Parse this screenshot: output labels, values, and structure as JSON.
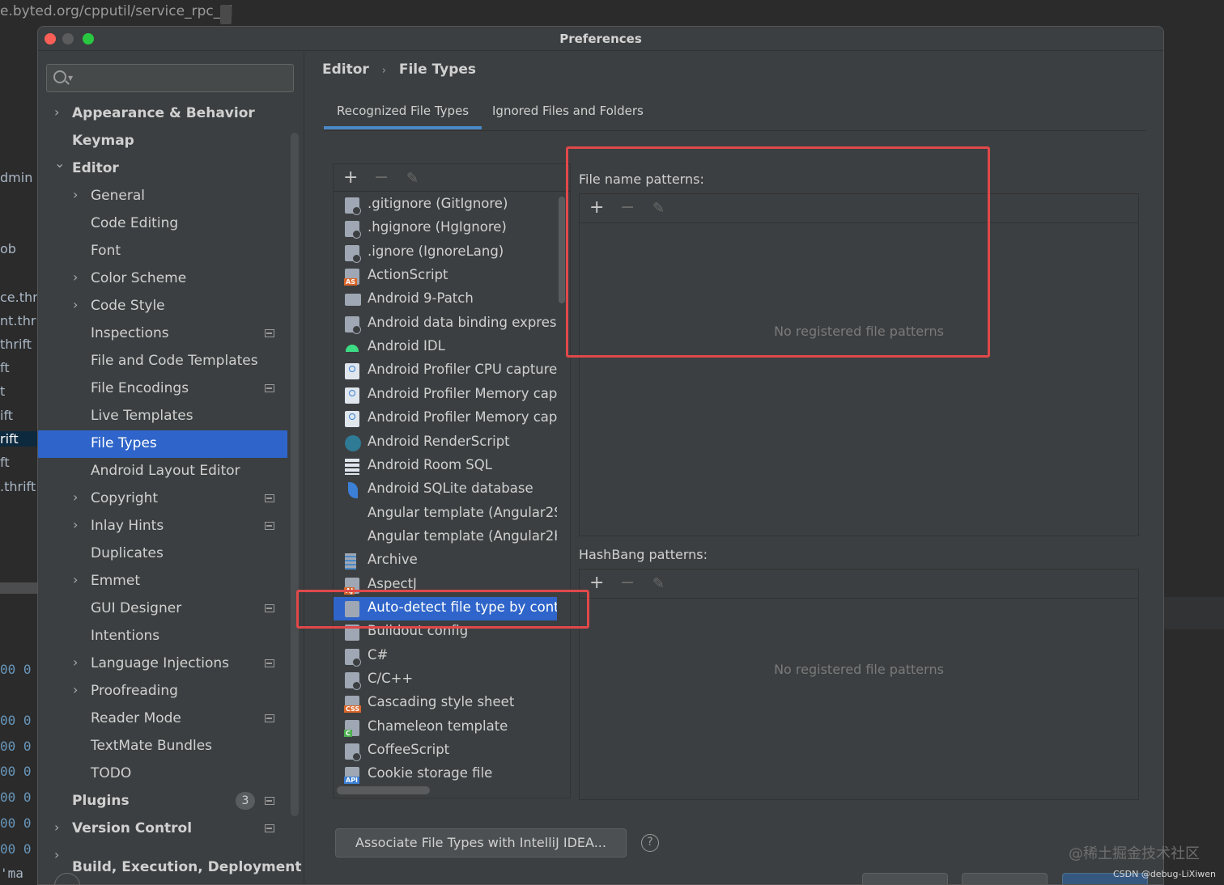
{
  "background": {
    "url_text": "e.byted.org/cpputil/service_rpc_id",
    "left_lines": [
      "dmin",
      "ob",
      "ce.thri",
      "nt.thri",
      "thrift",
      "ft",
      "t",
      "ift",
      "rift",
      "ft",
      ".thrift"
    ],
    "code_lines": [
      "00 0",
      "00 0",
      "00 0",
      "00 0",
      "00 0",
      "00 0",
      "00 0",
      "'ma"
    ],
    "watermark": "@稀土掘金技术社区",
    "watermark_small": "CSDN @debug-LiXiwen"
  },
  "dialog": {
    "title": "Preferences"
  },
  "sidebar": {
    "search_placeholder": "",
    "items": [
      {
        "label": "Appearance & Behavior",
        "bold": true,
        "chevron": "›",
        "indent": 0
      },
      {
        "label": "Keymap",
        "bold": true,
        "chevron": "",
        "indent": 0
      },
      {
        "label": "Editor",
        "bold": true,
        "chevron": "⌄",
        "indent": 0
      },
      {
        "label": "General",
        "chevron": "›",
        "indent": 1
      },
      {
        "label": "Code Editing",
        "chevron": "",
        "indent": 1
      },
      {
        "label": "Font",
        "chevron": "",
        "indent": 1
      },
      {
        "label": "Color Scheme",
        "chevron": "›",
        "indent": 1
      },
      {
        "label": "Code Style",
        "chevron": "›",
        "indent": 1
      },
      {
        "label": "Inspections",
        "chevron": "",
        "indent": 1,
        "pin": true
      },
      {
        "label": "File and Code Templates",
        "chevron": "",
        "indent": 1
      },
      {
        "label": "File Encodings",
        "chevron": "",
        "indent": 1,
        "pin": true
      },
      {
        "label": "Live Templates",
        "chevron": "",
        "indent": 1
      },
      {
        "label": "File Types",
        "chevron": "",
        "indent": 1,
        "selected": true
      },
      {
        "label": "Android Layout Editor",
        "chevron": "",
        "indent": 1
      },
      {
        "label": "Copyright",
        "chevron": "›",
        "indent": 1,
        "pin": true
      },
      {
        "label": "Inlay Hints",
        "chevron": "›",
        "indent": 1,
        "pin": true
      },
      {
        "label": "Duplicates",
        "chevron": "",
        "indent": 1
      },
      {
        "label": "Emmet",
        "chevron": "›",
        "indent": 1
      },
      {
        "label": "GUI Designer",
        "chevron": "",
        "indent": 1,
        "pin": true
      },
      {
        "label": "Intentions",
        "chevron": "",
        "indent": 1
      },
      {
        "label": "Language Injections",
        "chevron": "›",
        "indent": 1,
        "pin": true
      },
      {
        "label": "Proofreading",
        "chevron": "›",
        "indent": 1
      },
      {
        "label": "Reader Mode",
        "chevron": "",
        "indent": 1,
        "pin": true
      },
      {
        "label": "TextMate Bundles",
        "chevron": "",
        "indent": 1
      },
      {
        "label": "TODO",
        "chevron": "",
        "indent": 1
      },
      {
        "label": "Plugins",
        "bold": true,
        "chevron": "",
        "indent": 0,
        "badge": "3",
        "pin": true
      },
      {
        "label": "Version Control",
        "bold": true,
        "chevron": "›",
        "indent": 0,
        "pin": true
      },
      {
        "label": "Build, Execution, Deployment",
        "bold": true,
        "chevron": "›",
        "indent": 0
      }
    ]
  },
  "breadcrumb": {
    "parent": "Editor",
    "separator": "›",
    "current": "File Types"
  },
  "tabs": [
    {
      "label": "Recognized File Types",
      "active": true
    },
    {
      "label": "Ignored Files and Folders",
      "active": false
    }
  ],
  "toolbar": {
    "add": "+",
    "remove": "−",
    "edit": "✎"
  },
  "file_types": [
    {
      "name": ".gitignore (GitIgnore)",
      "icon": "doc"
    },
    {
      "name": ".hgignore (HgIgnore)",
      "icon": "doc"
    },
    {
      "name": ".ignore (IgnoreLang)",
      "icon": "doc"
    },
    {
      "name": "ActionScript",
      "icon": "tagged",
      "tag": "AS",
      "tag_color": "#d9652b"
    },
    {
      "name": "Android 9-Patch",
      "icon": "folder"
    },
    {
      "name": "Android data binding express",
      "icon": "doc"
    },
    {
      "name": "Android IDL",
      "icon": "green"
    },
    {
      "name": "Android Profiler CPU capture",
      "icon": "person"
    },
    {
      "name": "Android Profiler Memory capt",
      "icon": "person"
    },
    {
      "name": "Android Profiler Memory capt",
      "icon": "person"
    },
    {
      "name": "Android RenderScript",
      "icon": "rs"
    },
    {
      "name": "Android Room SQL",
      "icon": "table"
    },
    {
      "name": "Android SQLite database",
      "icon": "feather"
    },
    {
      "name": "Angular template (Angular2S",
      "icon": "blank"
    },
    {
      "name": "Angular template (Angular2H",
      "icon": "blank"
    },
    {
      "name": "Archive",
      "icon": "archive"
    },
    {
      "name": "AspectJ",
      "icon": "tagged",
      "tag": "AJ",
      "tag_color": "#d9652b"
    },
    {
      "name": "Auto-detect file type by cont",
      "icon": "plain",
      "selected": true
    },
    {
      "name": "Buildout config",
      "icon": "plain"
    },
    {
      "name": "C#",
      "icon": "doc"
    },
    {
      "name": "C/C++",
      "icon": "doc"
    },
    {
      "name": "Cascading style sheet",
      "icon": "tagged",
      "tag": "CSS",
      "tag_color": "#d9652b"
    },
    {
      "name": "Chameleon template",
      "icon": "tagged",
      "tag": "C",
      "tag_color": "#4caf50"
    },
    {
      "name": "CoffeeScript",
      "icon": "doc"
    },
    {
      "name": "Cookie storage file",
      "icon": "tagged",
      "tag": "API",
      "tag_color": "#3b7fd6"
    }
  ],
  "file_name_patterns": {
    "label": "File name patterns:",
    "empty": "No registered file patterns"
  },
  "hashbang_patterns": {
    "label": "HashBang patterns:",
    "empty": "No registered file patterns"
  },
  "associate_button": "Associate File Types with IntelliJ IDEA...",
  "help_icon": "?",
  "colors": {
    "selection": "#2f65ca",
    "highlight_box": "#e0484a",
    "tab_underline": "#4a88c7"
  }
}
